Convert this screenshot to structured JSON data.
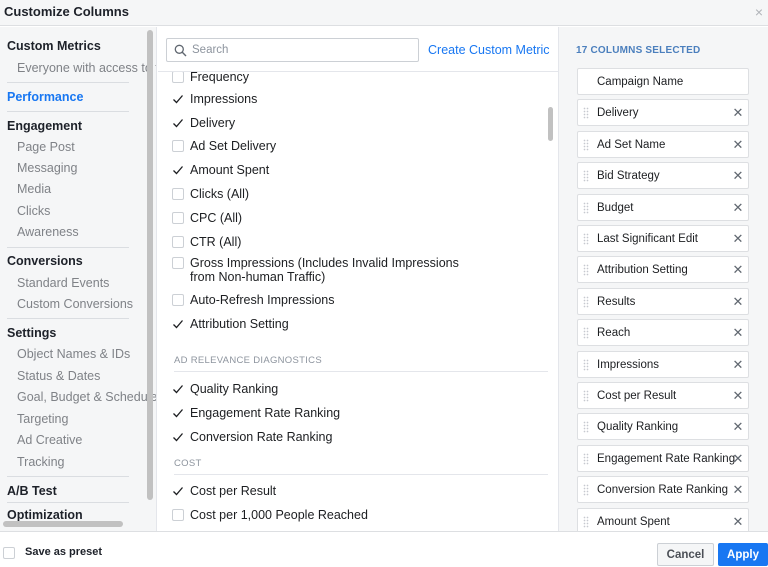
{
  "dialog": {
    "title": "Customize Columns",
    "close_glyph": "×"
  },
  "sidebar": {
    "items": [
      {
        "type": "heading",
        "label": "Custom Metrics",
        "active": false
      },
      {
        "type": "item",
        "label": "Everyone with access to this"
      },
      {
        "type": "heading",
        "label": "Performance",
        "active": true
      },
      {
        "type": "heading",
        "label": "Engagement",
        "active": false
      },
      {
        "type": "item",
        "label": "Page Post"
      },
      {
        "type": "item",
        "label": "Messaging"
      },
      {
        "type": "item",
        "label": "Media"
      },
      {
        "type": "item",
        "label": "Clicks"
      },
      {
        "type": "item",
        "label": "Awareness"
      },
      {
        "type": "heading",
        "label": "Conversions",
        "active": false
      },
      {
        "type": "item",
        "label": "Standard Events"
      },
      {
        "type": "item",
        "label": "Custom Conversions"
      },
      {
        "type": "heading",
        "label": "Settings",
        "active": false
      },
      {
        "type": "item",
        "label": "Object Names & IDs"
      },
      {
        "type": "item",
        "label": "Status & Dates"
      },
      {
        "type": "item",
        "label": "Goal, Budget & Schedule"
      },
      {
        "type": "item",
        "label": "Targeting"
      },
      {
        "type": "item",
        "label": "Ad Creative"
      },
      {
        "type": "item",
        "label": "Tracking"
      },
      {
        "type": "heading",
        "label": "A/B Test",
        "active": false
      },
      {
        "type": "heading",
        "label": "Optimization",
        "active": false
      }
    ]
  },
  "search": {
    "placeholder": "Search",
    "value": ""
  },
  "create_custom_metric": "Create Custom Metric",
  "metrics": [
    {
      "type": "row",
      "label": "Frequency",
      "checked": false
    },
    {
      "type": "row",
      "label": "Impressions",
      "checked": true
    },
    {
      "type": "row",
      "label": "Delivery",
      "checked": true
    },
    {
      "type": "row",
      "label": "Ad Set Delivery",
      "checked": false
    },
    {
      "type": "row",
      "label": "Amount Spent",
      "checked": true
    },
    {
      "type": "row",
      "label": "Clicks (All)",
      "checked": false
    },
    {
      "type": "row",
      "label": "CPC (All)",
      "checked": false
    },
    {
      "type": "row",
      "label": "CTR (All)",
      "checked": false
    },
    {
      "type": "row",
      "label": "Gross Impressions (Includes Invalid Impressions",
      "label2": "from Non-human Traffic)",
      "checked": false
    },
    {
      "type": "row",
      "label": "Auto-Refresh Impressions",
      "checked": false
    },
    {
      "type": "row",
      "label": "Attribution Setting",
      "checked": true
    },
    {
      "type": "section",
      "label": "AD RELEVANCE DIAGNOSTICS"
    },
    {
      "type": "row",
      "label": "Quality Ranking",
      "checked": true
    },
    {
      "type": "row",
      "label": "Engagement Rate Ranking",
      "checked": true
    },
    {
      "type": "row",
      "label": "Conversion Rate Ranking",
      "checked": true
    },
    {
      "type": "section",
      "label": "COST"
    },
    {
      "type": "row",
      "label": "Cost per Result",
      "checked": true
    },
    {
      "type": "row",
      "label": "Cost per 1,000 People Reached",
      "checked": false
    }
  ],
  "selected": {
    "count_label": "17 COLUMNS SELECTED",
    "columns": [
      {
        "label": "Campaign Name",
        "locked": true
      },
      {
        "label": "Delivery",
        "locked": false
      },
      {
        "label": "Ad Set Name",
        "locked": false
      },
      {
        "label": "Bid Strategy",
        "locked": false
      },
      {
        "label": "Budget",
        "locked": false
      },
      {
        "label": "Last Significant Edit",
        "locked": false
      },
      {
        "label": "Attribution Setting",
        "locked": false
      },
      {
        "label": "Results",
        "locked": false
      },
      {
        "label": "Reach",
        "locked": false
      },
      {
        "label": "Impressions",
        "locked": false
      },
      {
        "label": "Cost per Result",
        "locked": false
      },
      {
        "label": "Quality Ranking",
        "locked": false
      },
      {
        "label": "Engagement Rate Ranking",
        "locked": false
      },
      {
        "label": "Conversion Rate Ranking",
        "locked": false
      },
      {
        "label": "Amount Spent",
        "locked": false
      }
    ]
  },
  "footer": {
    "save_preset": "Save as preset",
    "cancel": "Cancel",
    "apply": "Apply"
  },
  "colors": {
    "accent": "#1877f2",
    "selected_count": "#4b7fbd",
    "muted": "#7f8287"
  }
}
